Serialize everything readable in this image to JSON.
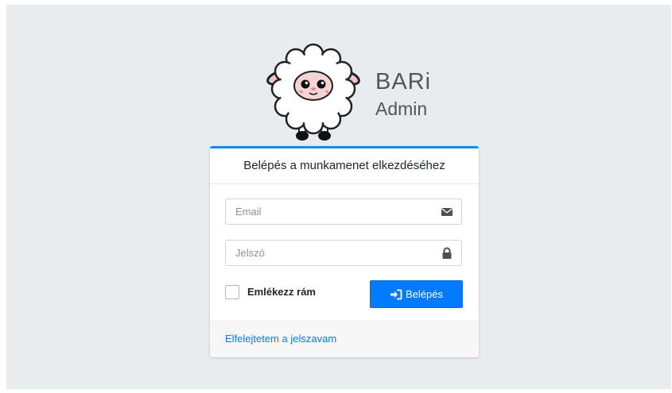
{
  "brand": {
    "title": "BARi",
    "subtitle": "Admin",
    "logo": "sheep-mascot"
  },
  "login": {
    "header": "Belépés a munkamenet elkezdéséhez",
    "email_placeholder": "Email",
    "email_value": "",
    "email_icon": "envelope-icon",
    "password_placeholder": "Jelszó",
    "password_value": "",
    "password_icon": "lock-icon",
    "remember_label": "Emlékezz rám",
    "remember_checked": false,
    "submit_label": "Belépés",
    "submit_icon": "sign-in-icon",
    "forgot_link": "Elfelejtetem a jelszavam"
  },
  "colors": {
    "accent": "#007bff",
    "card_top_border": "#1e88e5",
    "background": "#e9ecef"
  }
}
